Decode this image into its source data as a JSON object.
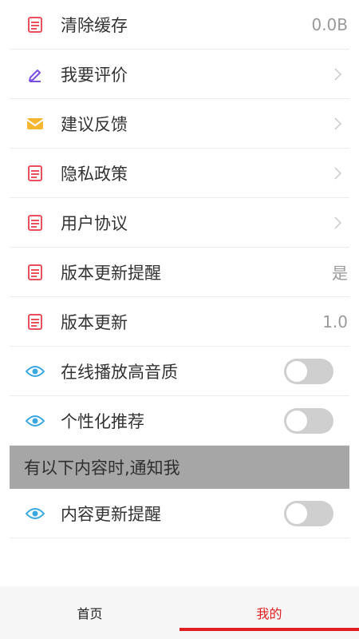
{
  "settings": {
    "clear_cache": {
      "label": "清除缓存",
      "value": "0.0B",
      "icon": "document-icon"
    },
    "rate": {
      "label": "我要评价",
      "icon": "pen-icon"
    },
    "feedback": {
      "label": "建议反馈",
      "icon": "envelope-icon"
    },
    "privacy": {
      "label": "隐私政策",
      "icon": "document-icon"
    },
    "agreement": {
      "label": "用户协议",
      "icon": "document-icon"
    },
    "update_reminder": {
      "label": "版本更新提醒",
      "value": "是",
      "icon": "document-icon"
    },
    "version": {
      "label": "版本更新",
      "value": "1.0",
      "icon": "document-icon"
    },
    "hq_audio": {
      "label": "在线播放高音质",
      "icon": "eye-icon",
      "enabled": false
    },
    "personalized": {
      "label": "个性化推荐",
      "icon": "eye-icon",
      "enabled": false
    }
  },
  "notify_section": {
    "title": "有以下内容时,通知我",
    "content_update": {
      "label": "内容更新提醒",
      "icon": "eye-icon",
      "enabled": false
    }
  },
  "tabbar": {
    "home": "首页",
    "mine": "我的",
    "active": "mine"
  },
  "colors": {
    "accent": "#e02020",
    "doc_icon": "#e8505b",
    "pen_icon": "#7b4fe0",
    "envelope_icon": "#f5b731",
    "eye_icon": "#3aa8e0",
    "section_bg": "#a6a6a6"
  }
}
